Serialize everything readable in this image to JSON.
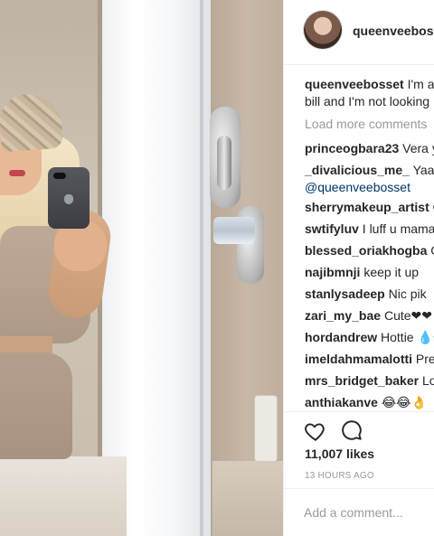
{
  "post": {
    "username": "queenveebosset",
    "avatar_icon": "profile-avatar"
  },
  "caption": {
    "username": "queenveebosset",
    "text_line1": "I'm as",
    "text_line2": "bill and I'm not looking"
  },
  "load_more": "Load more comments",
  "comments": [
    {
      "username": "princeogbara23",
      "text": "Vera yo"
    },
    {
      "username": "_divalicious_me_",
      "text": "Yaaaa",
      "mention": "@queenveebosset"
    },
    {
      "username": "sherrymakeup_artist",
      "text": "Qu"
    },
    {
      "username": "swtifyluv",
      "text": "I luff u mama"
    },
    {
      "username": "blessed_oriakhogba",
      "text": "Go"
    },
    {
      "username": "najibmnji",
      "text": "keep it up"
    },
    {
      "username": "stanlysadeep",
      "text": "Nic pik"
    },
    {
      "username": "zari_my_bae",
      "text": "Cute❤❤"
    },
    {
      "username": "hordandrew",
      "text": "Hottie 💧🔫"
    },
    {
      "username": "imeldahmamalotti",
      "text": "Pret"
    },
    {
      "username": "mrs_bridget_baker",
      "text": "Lol"
    },
    {
      "username": "anthiakanve",
      "text": "😂😂👌"
    }
  ],
  "actions": {
    "like_icon": "heart-icon",
    "comment_icon": "speech-bubble-icon",
    "likes": "11,007 likes",
    "timestamp": "13 HOURS AGO",
    "add_comment_placeholder": "Add a comment..."
  }
}
